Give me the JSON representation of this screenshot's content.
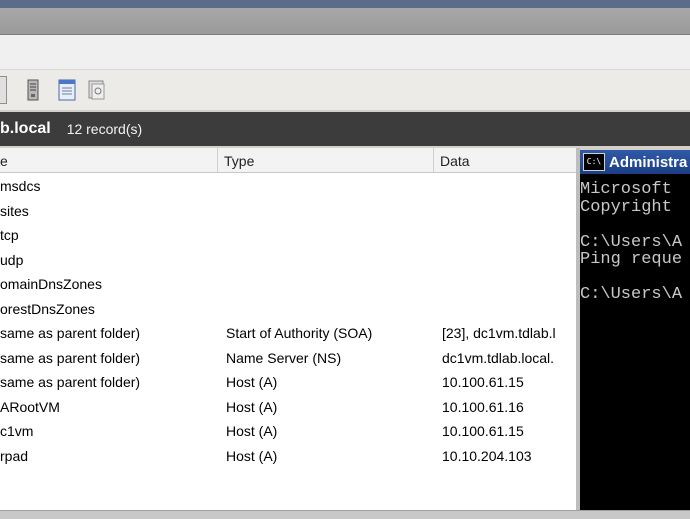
{
  "path": {
    "zone_label": "b.local",
    "record_count": "12 record(s)"
  },
  "columns": [
    "e",
    "Type",
    "Data"
  ],
  "records": [
    {
      "name": "msdcs",
      "type": "",
      "data": ""
    },
    {
      "name": "sites",
      "type": "",
      "data": ""
    },
    {
      "name": "tcp",
      "type": "",
      "data": ""
    },
    {
      "name": "udp",
      "type": "",
      "data": ""
    },
    {
      "name": "omainDnsZones",
      "type": "",
      "data": ""
    },
    {
      "name": "orestDnsZones",
      "type": "",
      "data": ""
    },
    {
      "name": "same as parent folder)",
      "type": "Start of Authority (SOA)",
      "data": "[23], dc1vm.tdlab.l"
    },
    {
      "name": "same as parent folder)",
      "type": "Name Server (NS)",
      "data": "dc1vm.tdlab.local."
    },
    {
      "name": "same as parent folder)",
      "type": "Host (A)",
      "data": "10.100.61.15"
    },
    {
      "name": "ARootVM",
      "type": "Host (A)",
      "data": "10.100.61.16"
    },
    {
      "name": "c1vm",
      "type": "Host (A)",
      "data": "10.100.61.15"
    },
    {
      "name": "rpad",
      "type": "Host (A)",
      "data": "10.10.204.103"
    }
  ],
  "cmd": {
    "title": "Administra",
    "icon_text": "C:\\",
    "lines": [
      "Microsoft",
      "Copyright",
      "",
      "C:\\Users\\A",
      "Ping reque",
      "",
      "C:\\Users\\A"
    ]
  },
  "icons": [
    "server-icon",
    "properties-icon",
    "refresh-icon",
    "console-icon"
  ]
}
